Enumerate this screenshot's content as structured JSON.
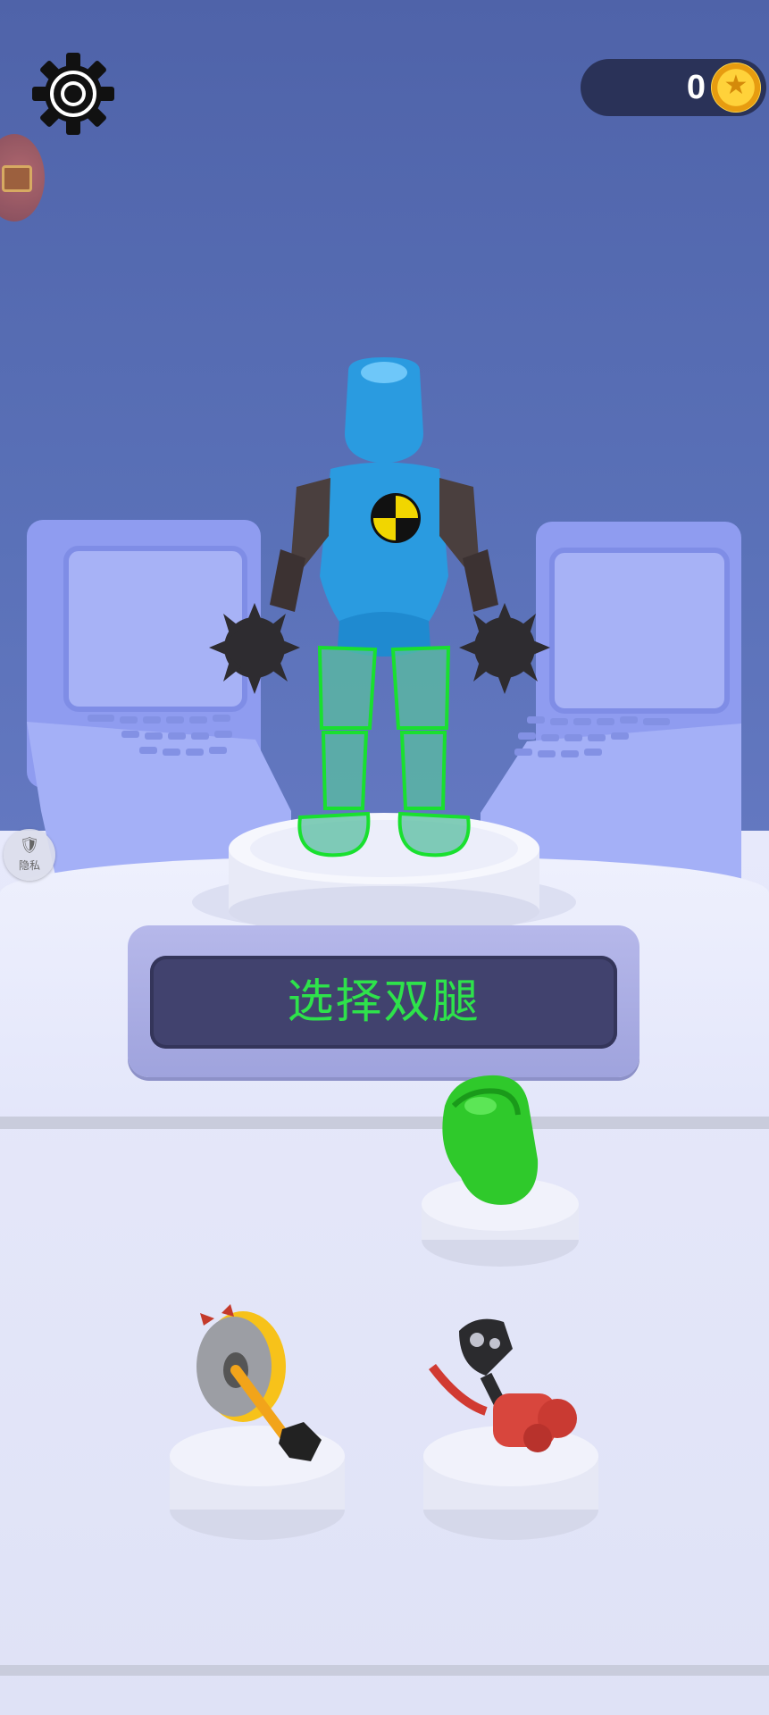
{
  "hud": {
    "coin_count": "0",
    "privacy_label": "隐私"
  },
  "prompt": {
    "text": "选择双腿"
  },
  "icons": {
    "settings": "gear-icon",
    "chest": "treasure-chest-icon",
    "coin": "star-coin-icon",
    "privacy": "shield-icon"
  },
  "colors": {
    "wall": "#5a6fb6",
    "floor": "#e6e8f8",
    "robot_body": "#2a9be0",
    "leg_highlight": "#19e02f",
    "prompt_text": "#2ee24b",
    "prompt_panel": "#41426e"
  },
  "choices": [
    {
      "name": "green-fist"
    },
    {
      "name": "circular-saw"
    },
    {
      "name": "red-blaster"
    }
  ]
}
